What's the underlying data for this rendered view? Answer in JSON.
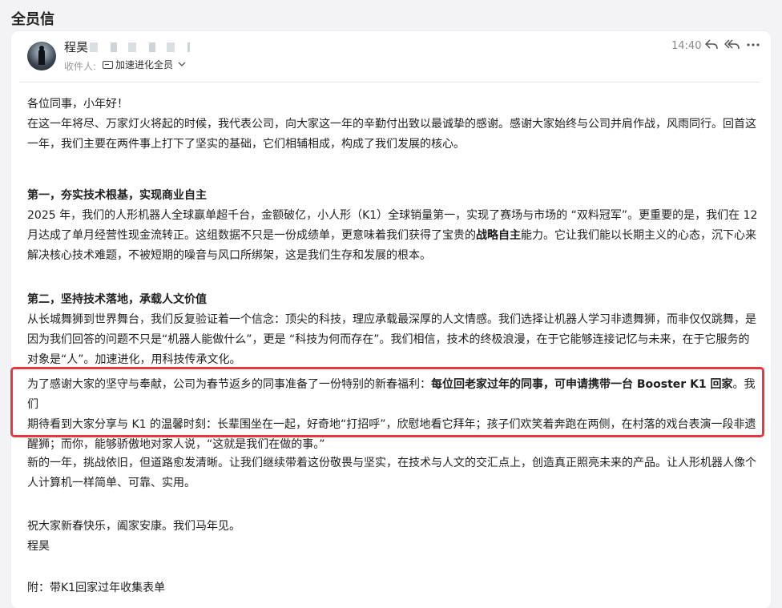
{
  "window": {
    "title": "全员信"
  },
  "header": {
    "sender_name": "程昊",
    "recipient_label": "收件人:",
    "recipient_group": "加速进化全员",
    "time": "14:40"
  },
  "icons": {
    "reply": "reply-icon",
    "reply_all": "reply-all-icon",
    "more": "more-icon",
    "group": "group-icon",
    "chevron": "chevron-down-icon"
  },
  "body": {
    "greeting": "各位同事，小年好！",
    "intro_1": "在这一年将尽、万家灯火将起的时候，我代表公司，向大家这一年的辛勤付出致以最诚挚的感谢。感谢大家始终与公司并肩作战，风雨同行。回首这",
    "intro_2": "一年，我们主要在两件事上打下了坚实的基础，它们相辅相成，构成了我们发展的核心。",
    "section1_title": "第一，夯实技术根基，实现商业自主",
    "section1_line1": "2025 年，我们的人形机器人全球赢单超千台，金额破亿，小人形（K1）全球销量第一，实现了赛场与市场的 “双料冠军”。更重要的是，我们在 12",
    "section1_line2_a": "月达成了单月经营性现金流转正。这组数据不只是一份成绩单，更意味着我们获得了宝贵的",
    "section1_line2_bold": "战略自主",
    "section1_line2_b": "能力。它让我们能以长期主义的心态，沉下心来",
    "section1_line3": "解决核心技术难题，不被短期的噪音与风口所绑架，这是我们生存和发展的根本。",
    "section2_title": "第二，坚持技术落地，承载人文价值",
    "section2_line1": "从长城舞狮到世界舞台，我们反复验证着一个信念：顶尖的科技，理应承载最深厚的人文情感。我们选择让机器人学习非遗舞狮，而非仅仅跳舞，是",
    "section2_line2": "因为我们回答的问题不只是“机器人能做什么”，更是 “科技为何而存在”。我们相信，技术的终极浪漫，在于它能够连接记忆与未来，在于它服务的",
    "section2_line3": "对象是“人”。加速进化，用科技传承文化。",
    "highlight_line1_a": "为了感谢大家的坚守与奉献，公司为春节返乡的同事准备了一份特别的新春福利：",
    "highlight_line1_bold": "每位回老家过年的同事，可申请携带一台 Booster K1 回家",
    "highlight_line1_b": "。我们",
    "highlight_line2": "期待看到大家分享与 K1 的温馨时刻：长辈围坐在一起，好奇地“打招呼”，欣慰地看它拜年；孩子们欢笑着奔跑在两侧，在村落的戏台表演一段非遗",
    "highlight_line3": "醒狮；而你，能够骄傲地对家人说，“这就是我们在做的事。”",
    "closing_line1": "新的一年，挑战依旧，但道路愈发清晰。让我们继续带着这份敬畏与坚实，在技术与人文的交汇点上，创造真正照亮未来的产品。让人形机器人像个",
    "closing_line2": "人计算机一样简单、可靠、实用。",
    "wish": "祝大家新春快乐，阖家安康。我们马年见。",
    "signature": "程昊",
    "attachment": "附：带K1回家过年收集表单"
  },
  "colors": {
    "highlight_border": "#e8383d",
    "background": "#f3f3f5",
    "card": "#ffffff"
  }
}
